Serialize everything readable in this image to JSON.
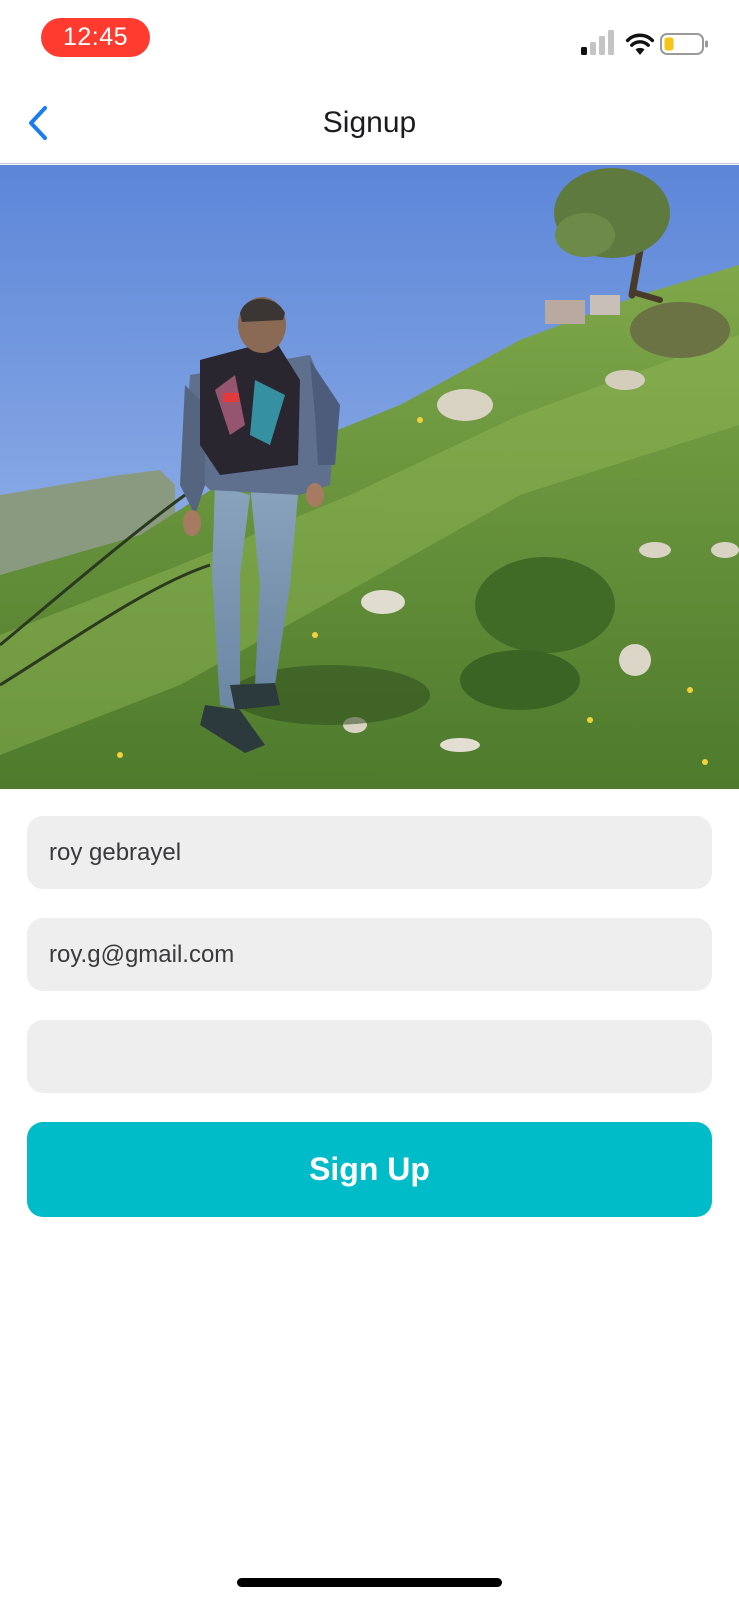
{
  "status_bar": {
    "time": "12:45",
    "time_pill_color": "#ff3b30",
    "icons": [
      "signal-icon",
      "wifi-icon",
      "battery-icon"
    ],
    "battery_color": "#f5c518"
  },
  "nav": {
    "title": "Signup",
    "back_icon": "chevron-left-icon",
    "accent_color": "#1a7cf0"
  },
  "hero_image": {
    "subject": "photo"
  },
  "form": {
    "name_value": "roy gebrayel",
    "email_value": "roy.g@gmail.com",
    "password_value": "",
    "submit_label": "Sign Up",
    "submit_color": "#00bcc9",
    "field_background": "#eeeeee"
  }
}
